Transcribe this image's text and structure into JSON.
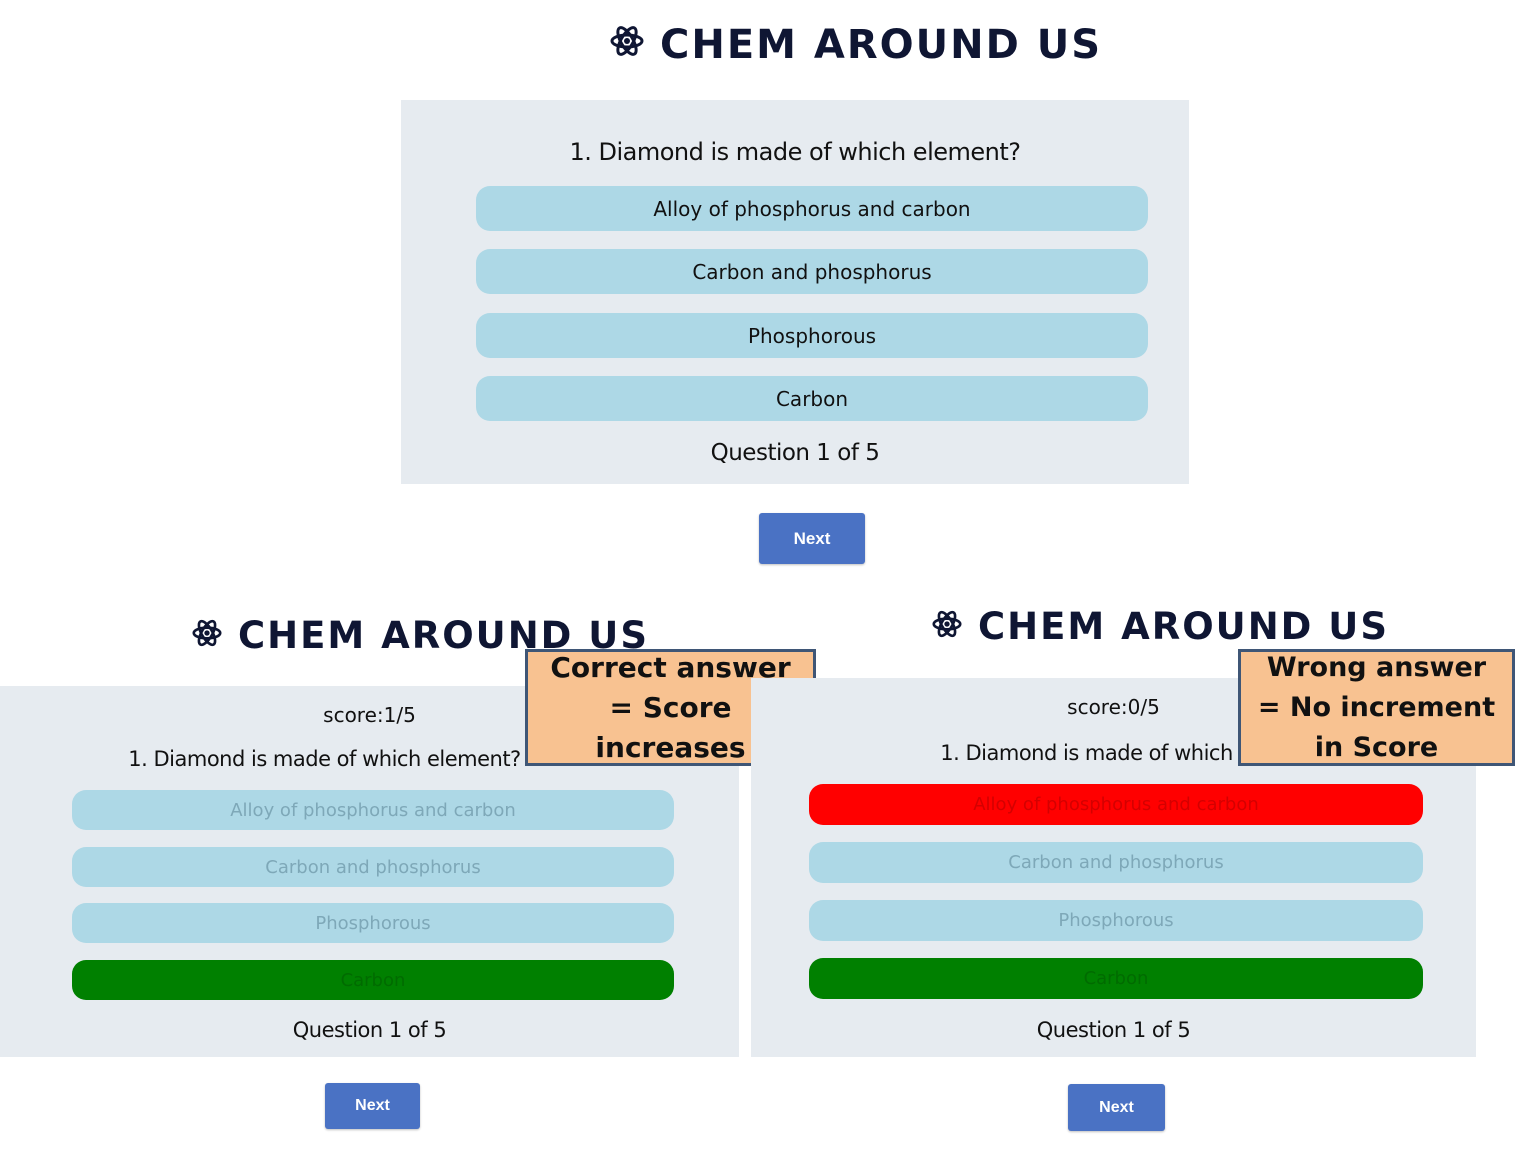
{
  "app_title": "CHEM AROUND US",
  "question": "1. Diamond is made of which element?",
  "question_truncated_left": "1. Diamond is made of which element?",
  "question_truncated_right": "1. Diamond is made of which el",
  "options": [
    "Alloy of phosphorus and carbon",
    "Carbon and phosphorus",
    "Phosphorous",
    "Carbon"
  ],
  "progress": "Question 1 of 5",
  "next_label": "Next",
  "score_correct": "score:1/5",
  "score_wrong": "score:0/5",
  "callout_correct": "Correct answer = Score increases",
  "callout_wrong": "Wrong answer = No increment in Score",
  "colors": {
    "option_bg": "#add8e6",
    "correct": "#008000",
    "wrong": "#ff0000",
    "card_bg": "#e6ebf0",
    "next_bg": "#4a72c4",
    "callout_bg": "#f8c291",
    "title": "#0f1633"
  },
  "icon": "atom-icon"
}
